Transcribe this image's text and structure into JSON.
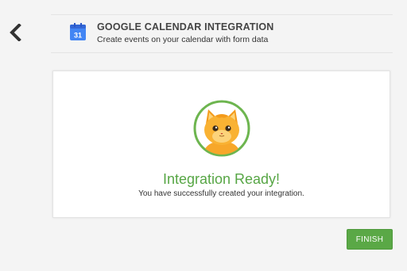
{
  "header": {
    "title": "GOOGLE CALENDAR INTEGRATION",
    "subtitle": "Create events on your calendar with form data",
    "icon": "google-calendar-icon",
    "icon_text": "31"
  },
  "back": {
    "icon": "chevron-left-icon"
  },
  "card": {
    "mascot": "cat-mascot-icon",
    "title": "Integration Ready!",
    "message": "You have successfully created your integration."
  },
  "actions": {
    "finish_label": "FINISH"
  },
  "colors": {
    "success_green": "#57a645",
    "button_green": "#5aa846",
    "calendar_blue": "#4285f4",
    "mascot_ring": "#6db54f",
    "mascot_orange": "#f7a72a"
  }
}
